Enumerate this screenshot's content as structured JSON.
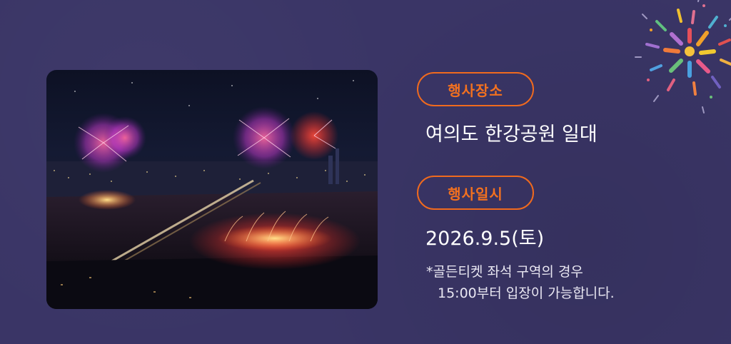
{
  "photo": {
    "description_icon": "fireworks-photo"
  },
  "venue": {
    "label": "행사장소",
    "value": "여의도 한강공원 일대"
  },
  "date": {
    "label": "행사일시",
    "value": "2026.9.5(토)"
  },
  "note": {
    "line1": "*골든티켓 좌석 구역의 경우",
    "line2": "15:00부터 입장이 가능합니다."
  },
  "colors": {
    "background": "#3a3566",
    "accent": "#f06a1e",
    "text": "#ffffff"
  }
}
